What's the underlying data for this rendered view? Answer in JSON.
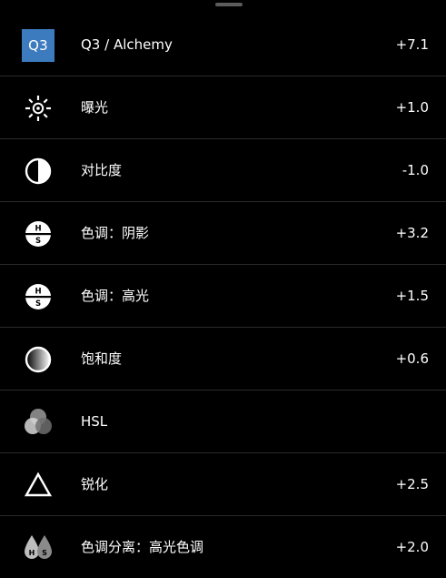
{
  "adjustments": [
    {
      "icon": "q3-alchemy-icon",
      "icon_text": "Q3",
      "label": "Q3 / Alchemy",
      "value": "+7.1"
    },
    {
      "icon": "exposure-sun-icon",
      "label": "曝光",
      "value": "+1.0"
    },
    {
      "icon": "contrast-icon",
      "label": "对比度",
      "value": "-1.0"
    },
    {
      "icon": "hs-shadows-icon",
      "label": "色调：阴影",
      "value": "+3.2"
    },
    {
      "icon": "hs-highlights-icon",
      "label": "色调：高光",
      "value": "+1.5"
    },
    {
      "icon": "saturation-gradient-icon",
      "label": "饱和度",
      "value": "+0.6"
    },
    {
      "icon": "hsl-circles-icon",
      "label": "HSL",
      "value": ""
    },
    {
      "icon": "sharpen-triangle-icon",
      "label": "锐化",
      "value": "+2.5"
    },
    {
      "icon": "split-tone-drops-icon",
      "label": "色调分离：高光色调",
      "value": "+2.0"
    }
  ],
  "colors": {
    "background": "#000000",
    "divider": "#2a2a2a",
    "accent_badge": "#3d7bbf",
    "text": "#ffffff"
  }
}
